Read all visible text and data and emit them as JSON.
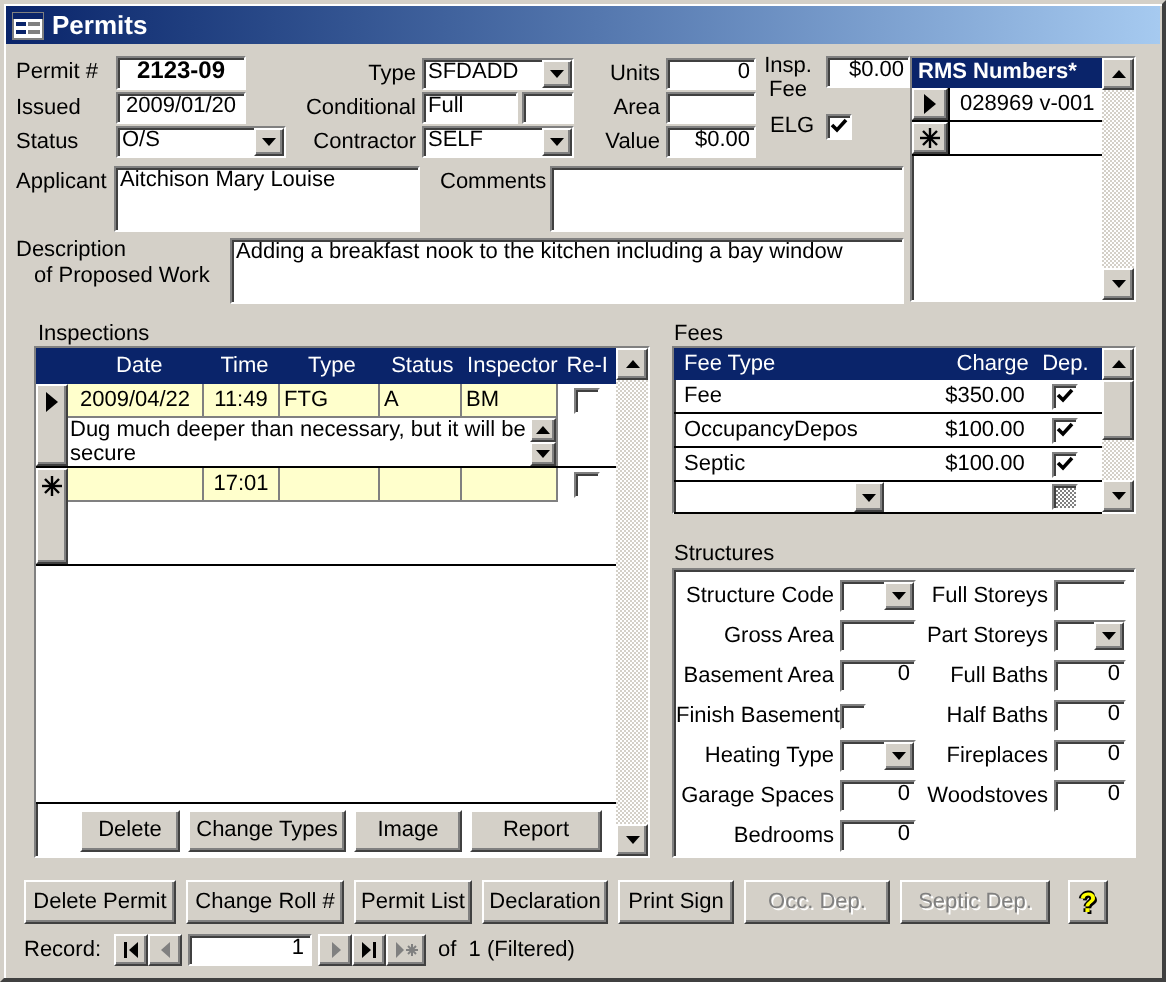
{
  "window": {
    "title": "Permits"
  },
  "permit_number": {
    "label": "Permit #",
    "value": "2123-09"
  },
  "issued": {
    "label": "Issued",
    "value": "2009/01/20"
  },
  "status": {
    "label": "Status",
    "value": "O/S"
  },
  "type": {
    "label": "Type",
    "value": "SFDADD"
  },
  "conditional": {
    "label": "Conditional",
    "value": "Full"
  },
  "contractor": {
    "label": "Contractor",
    "value": "SELF"
  },
  "units": {
    "label": "Units",
    "value": "0"
  },
  "area": {
    "label": "Area"
  },
  "value": {
    "label": "Value",
    "value": "$0.00"
  },
  "insp_fee": {
    "label": "Insp. Fee",
    "value": "$0.00"
  },
  "elg": {
    "label": "ELG",
    "checked": true
  },
  "applicant": {
    "label": "Applicant",
    "value": "Aitchison Mary Louise"
  },
  "comments": {
    "label": "Comments"
  },
  "description": {
    "label_lines": [
      "Description",
      "of Proposed Work"
    ],
    "value": "Adding a breakfast nook to the kitchen including a bay window"
  },
  "rms_numbers": {
    "title": "RMS Numbers*",
    "rows": [
      {
        "kind": "record",
        "value": "028969 v-001",
        "selected": true
      },
      {
        "kind": "new",
        "selected": false
      }
    ]
  },
  "inspections": {
    "label": "Inspections",
    "columns": [
      "Date",
      "Time",
      "Type",
      "Status",
      "Inspector",
      "Re-I"
    ],
    "rows": [
      {
        "kind": "record",
        "selected": true,
        "date": "2009/04/22",
        "time": "11:49",
        "type": "FTG",
        "status": "A",
        "inspector": "BM",
        "reinspect": false,
        "note": "Dug much deeper than necessary, but it will be secure"
      },
      {
        "kind": "new",
        "selected": false,
        "time": "17:01",
        "reinspect": false
      }
    ],
    "buttons": [
      "Delete",
      "Change Types",
      "Image",
      "Report"
    ]
  },
  "fees": {
    "label": "Fees",
    "columns": [
      "Fee Type",
      "Charge",
      "Dep."
    ],
    "rows": [
      {
        "kind": "record",
        "fee_type": "Fee",
        "charge": "$350.00",
        "dep": true
      },
      {
        "kind": "record",
        "fee_type": "OccupancyDepos",
        "charge": "$100.00",
        "dep": true
      },
      {
        "kind": "record",
        "fee_type": "Septic",
        "charge": "$100.00",
        "dep": true
      },
      {
        "kind": "new",
        "dep": null
      }
    ]
  },
  "structures": {
    "label": "Structures",
    "left": [
      {
        "kind": "combo",
        "label": "Structure Code"
      },
      {
        "kind": "text",
        "label": "Gross Area"
      },
      {
        "kind": "text",
        "label": "Basement Area",
        "value": "0"
      },
      {
        "kind": "check",
        "label": "Finish Basement",
        "checked": false
      },
      {
        "kind": "combo",
        "label": "Heating Type"
      },
      {
        "kind": "text",
        "label": "Garage Spaces",
        "value": "0"
      },
      {
        "kind": "text",
        "label": "Bedrooms",
        "value": "0"
      }
    ],
    "right": [
      {
        "kind": "text",
        "label": "Full Storeys"
      },
      {
        "kind": "combo",
        "label": "Part Storeys"
      },
      {
        "kind": "text",
        "label": "Full Baths",
        "value": "0"
      },
      {
        "kind": "text",
        "label": "Half Baths",
        "value": "0"
      },
      {
        "kind": "text",
        "label": "Fireplaces",
        "value": "0"
      },
      {
        "kind": "text",
        "label": "Woodstoves",
        "value": "0"
      }
    ]
  },
  "buttons": [
    {
      "label": "Delete Permit",
      "disabled": false
    },
    {
      "label": "Change Roll #",
      "disabled": false
    },
    {
      "label": "Permit List",
      "disabled": false
    },
    {
      "label": "Declaration",
      "disabled": false
    },
    {
      "label": "Print Sign",
      "disabled": false
    },
    {
      "label": "Occ. Dep.",
      "disabled": true
    },
    {
      "label": "Septic Dep.",
      "disabled": true
    }
  ],
  "help_button": {
    "symbol": "?"
  },
  "record_nav": {
    "label": "Record:",
    "value": "1",
    "total": "of  1 (Filtered)",
    "buttons": [
      {
        "kind": "first",
        "disabled": false
      },
      {
        "kind": "previous",
        "disabled": true
      },
      {
        "kind": "next",
        "disabled": true
      },
      {
        "kind": "last",
        "disabled": false
      },
      {
        "kind": "new",
        "disabled": true
      }
    ]
  }
}
